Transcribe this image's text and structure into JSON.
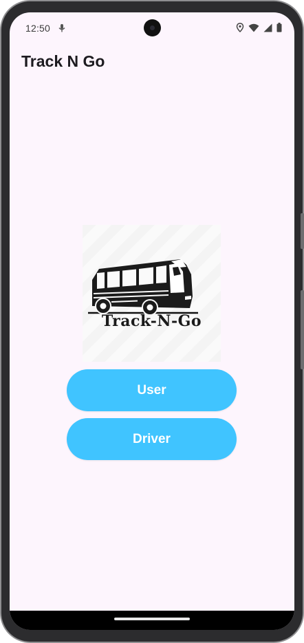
{
  "status_bar": {
    "time": "12:50",
    "icons": [
      "mic-icon",
      "location-icon",
      "wifi-icon",
      "signal-icon",
      "battery-icon"
    ]
  },
  "app_bar": {
    "title": "Track N Go"
  },
  "logo": {
    "icon": "bus-icon",
    "text": "Track-N-Go"
  },
  "buttons": {
    "user_label": "User",
    "driver_label": "Driver"
  },
  "colors": {
    "background": "#fdf5fd",
    "button": "#40c4ff",
    "button_text": "#ffffff",
    "title": "#1d1b20"
  }
}
